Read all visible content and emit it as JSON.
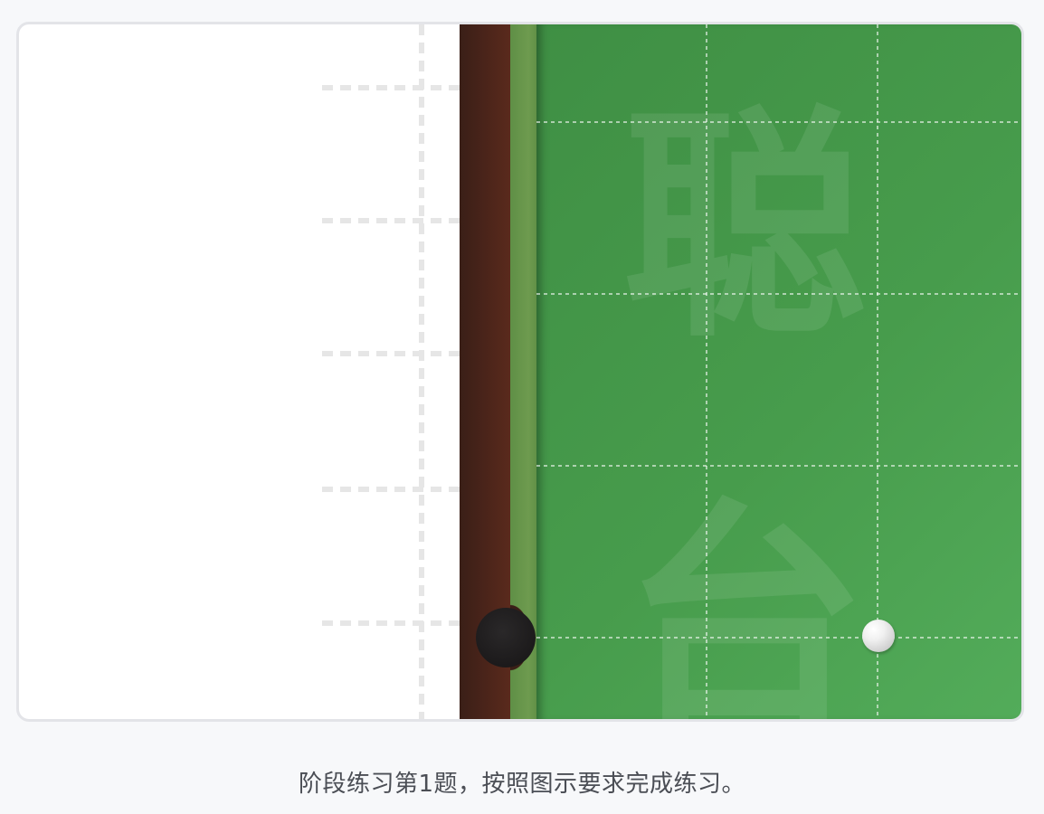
{
  "exercise": {
    "caption": "阶段练习第1题，按照图示要求完成练习。"
  },
  "table": {
    "watermark_top": "聪",
    "watermark_bottom": "台",
    "colors": {
      "felt": "#479c4c",
      "rail_wood": "#4a241a",
      "cushion": "#6e9b4f",
      "pocket": "#1c1a1b",
      "ball": "#f0f0f0"
    }
  }
}
